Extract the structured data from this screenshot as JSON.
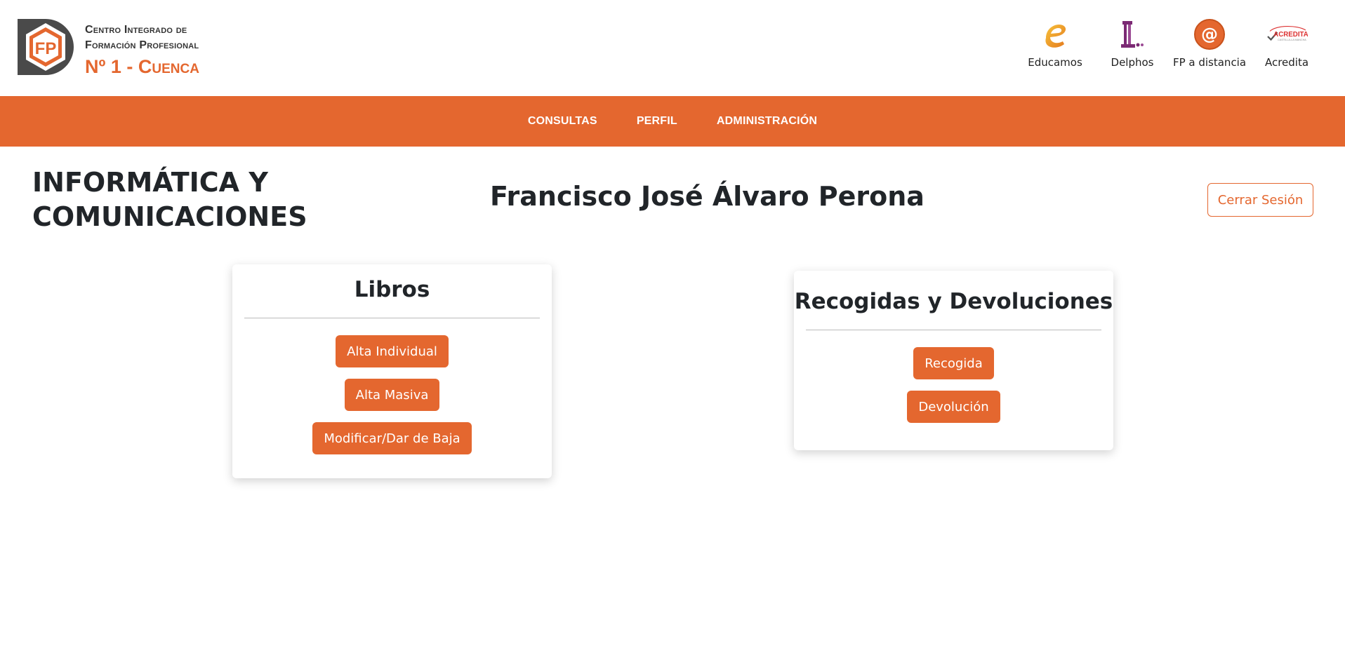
{
  "brand": {
    "line1": "Centro Integrado de",
    "line2": "Formación Profesional",
    "line3": "Nº 1 - Cuenca",
    "logo_text": "FP"
  },
  "ext_links": [
    {
      "label": "Educamos",
      "icon": "educamos-icon"
    },
    {
      "label": "Delphos",
      "icon": "delphos-icon"
    },
    {
      "label": "FP a distancia",
      "icon": "fp-distancia-icon"
    },
    {
      "label": "Acredita",
      "icon": "acredita-icon",
      "logo_text": "ACREDITA",
      "logo_subtext": "CASTILLA-LA MANCHA"
    }
  ],
  "nav": {
    "consultas": "CONSULTAS",
    "perfil": "PERFIL",
    "administracion": "ADMINISTRACIÓN"
  },
  "page": {
    "department": "INFORMÁTICA Y COMUNICACIONES",
    "user_name": "Francisco José Álvaro Perona",
    "logout_label": "Cerrar Sesión"
  },
  "cards": {
    "libros": {
      "title": "Libros",
      "buttons": [
        "Alta Individual",
        "Alta Masiva",
        "Modificar/Dar de Baja"
      ]
    },
    "recogidas": {
      "title": "Recogidas y Devoluciones",
      "buttons": [
        "Recogida",
        "Devolución"
      ]
    }
  },
  "colors": {
    "accent": "#e4672f",
    "text": "#212529",
    "logo_dark": "#4a4a4a"
  }
}
